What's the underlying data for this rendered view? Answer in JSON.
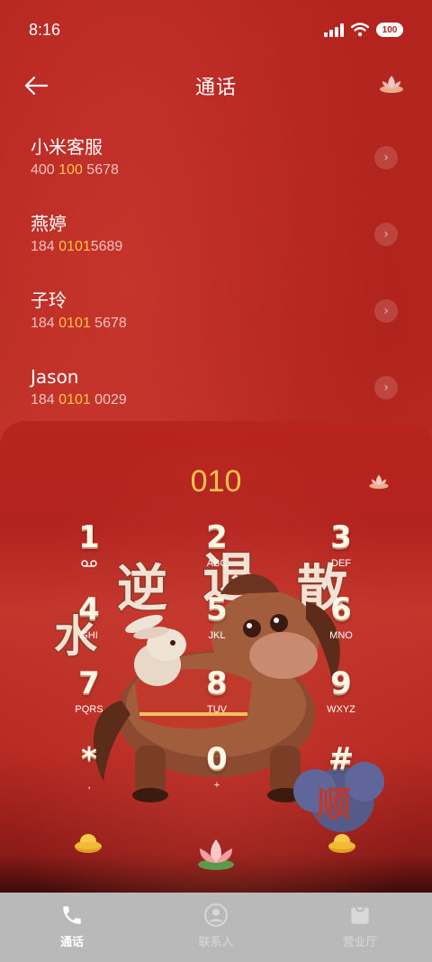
{
  "status_bar": {
    "time": "8:16",
    "battery": "100"
  },
  "header": {
    "title": "通话"
  },
  "contacts": [
    {
      "name": "小米客服",
      "number_parts": [
        "400 ",
        "100",
        " 5678"
      ]
    },
    {
      "name": "燕婷",
      "number_parts": [
        "184 ",
        "0101",
        "5689"
      ]
    },
    {
      "name": "子玲",
      "number_parts": [
        "184 ",
        "0101",
        " 5678"
      ]
    },
    {
      "name": "Jason",
      "number_parts": [
        "184 ",
        "0101",
        " 0029"
      ]
    }
  ],
  "dialer": {
    "input": "010",
    "keys": [
      {
        "digit": "1",
        "letters": ""
      },
      {
        "digit": "2",
        "letters": "ABC"
      },
      {
        "digit": "3",
        "letters": "DEF"
      },
      {
        "digit": "4",
        "letters": "GHI"
      },
      {
        "digit": "5",
        "letters": "JKL"
      },
      {
        "digit": "6",
        "letters": "MNO"
      },
      {
        "digit": "7",
        "letters": "PQRS"
      },
      {
        "digit": "8",
        "letters": "TUV"
      },
      {
        "digit": "9",
        "letters": "WXYZ"
      },
      {
        "digit": "*",
        "letters": ","
      },
      {
        "digit": "0",
        "letters": "+"
      },
      {
        "digit": "#",
        "letters": ""
      }
    ],
    "illustration_text": [
      "水",
      "逆",
      "退",
      "散",
      "顺"
    ]
  },
  "nav": [
    {
      "label": "通话",
      "icon": "phone-icon"
    },
    {
      "label": "联系人",
      "icon": "contact-icon"
    },
    {
      "label": "营业厅",
      "icon": "store-icon"
    }
  ],
  "colors": {
    "background": "#b2231f",
    "highlight": "#ffc24a",
    "nav_bg": "#b9b9b9"
  }
}
